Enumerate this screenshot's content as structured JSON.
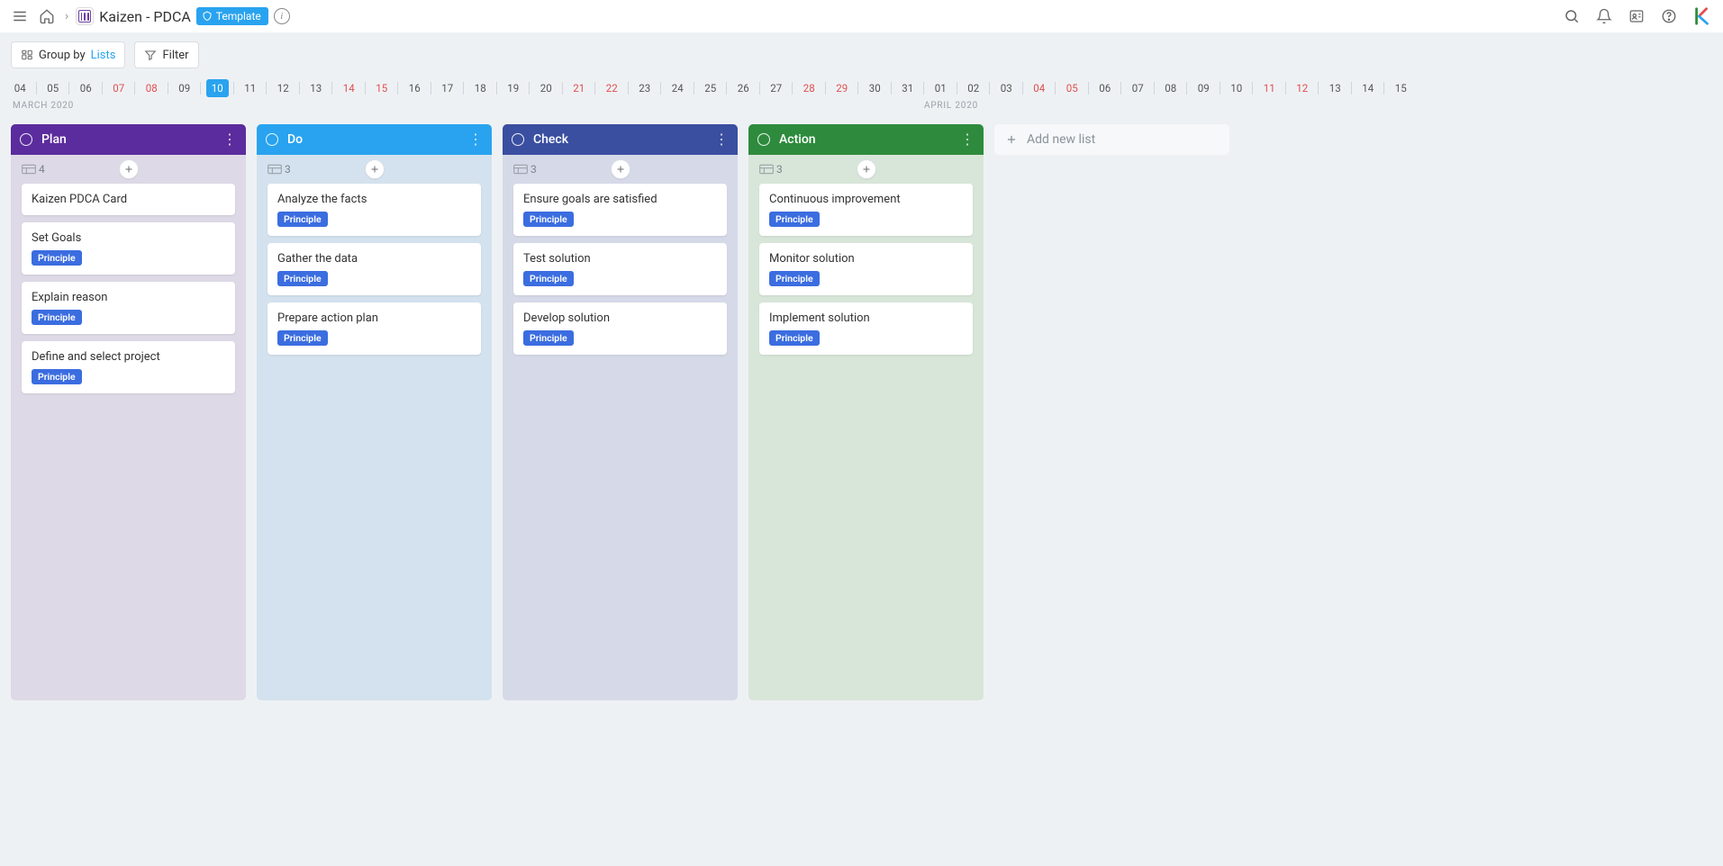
{
  "header": {
    "title": "Kaizen - PDCA",
    "template_label": "Template"
  },
  "toolbar": {
    "group_by_label": "Group by",
    "group_by_value": "Lists",
    "filter_label": "Filter"
  },
  "timeline": {
    "month_left": "MARCH 2020",
    "month_right": "APRIL 2020",
    "selected": "10",
    "days": [
      {
        "d": "04",
        "weekend": false
      },
      {
        "d": "05",
        "weekend": false
      },
      {
        "d": "06",
        "weekend": false
      },
      {
        "d": "07",
        "weekend": true
      },
      {
        "d": "08",
        "weekend": true
      },
      {
        "d": "09",
        "weekend": false
      },
      {
        "d": "10",
        "weekend": false
      },
      {
        "d": "11",
        "weekend": false
      },
      {
        "d": "12",
        "weekend": false
      },
      {
        "d": "13",
        "weekend": false
      },
      {
        "d": "14",
        "weekend": true
      },
      {
        "d": "15",
        "weekend": true
      },
      {
        "d": "16",
        "weekend": false
      },
      {
        "d": "17",
        "weekend": false
      },
      {
        "d": "18",
        "weekend": false
      },
      {
        "d": "19",
        "weekend": false
      },
      {
        "d": "20",
        "weekend": false
      },
      {
        "d": "21",
        "weekend": true
      },
      {
        "d": "22",
        "weekend": true
      },
      {
        "d": "23",
        "weekend": false
      },
      {
        "d": "24",
        "weekend": false
      },
      {
        "d": "25",
        "weekend": false
      },
      {
        "d": "26",
        "weekend": false
      },
      {
        "d": "27",
        "weekend": false
      },
      {
        "d": "28",
        "weekend": true
      },
      {
        "d": "29",
        "weekend": true
      },
      {
        "d": "30",
        "weekend": false
      },
      {
        "d": "31",
        "weekend": false
      },
      {
        "d": "01",
        "weekend": false
      },
      {
        "d": "02",
        "weekend": false
      },
      {
        "d": "03",
        "weekend": false
      },
      {
        "d": "04",
        "weekend": true
      },
      {
        "d": "05",
        "weekend": true
      },
      {
        "d": "06",
        "weekend": false
      },
      {
        "d": "07",
        "weekend": false
      },
      {
        "d": "08",
        "weekend": false
      },
      {
        "d": "09",
        "weekend": false
      },
      {
        "d": "10",
        "weekend": false
      },
      {
        "d": "11",
        "weekend": true
      },
      {
        "d": "12",
        "weekend": true
      },
      {
        "d": "13",
        "weekend": false
      },
      {
        "d": "14",
        "weekend": false
      },
      {
        "d": "15",
        "weekend": false
      }
    ]
  },
  "board": {
    "add_list_label": "Add new list",
    "columns": [
      {
        "key": "plan",
        "title": "Plan",
        "count": "4",
        "cards": [
          {
            "title": "Kaizen PDCA Card",
            "label": null
          },
          {
            "title": "Set Goals",
            "label": "Principle"
          },
          {
            "title": "Explain reason",
            "label": "Principle"
          },
          {
            "title": "Define and select project",
            "label": "Principle"
          }
        ]
      },
      {
        "key": "do",
        "title": "Do",
        "count": "3",
        "cards": [
          {
            "title": "Analyze the facts",
            "label": "Principle"
          },
          {
            "title": "Gather the data",
            "label": "Principle"
          },
          {
            "title": "Prepare action plan",
            "label": "Principle"
          }
        ]
      },
      {
        "key": "check",
        "title": "Check",
        "count": "3",
        "cards": [
          {
            "title": "Ensure goals are satisfied",
            "label": "Principle"
          },
          {
            "title": "Test solution",
            "label": "Principle"
          },
          {
            "title": "Develop solution",
            "label": "Principle"
          }
        ]
      },
      {
        "key": "action",
        "title": "Action",
        "count": "3",
        "cards": [
          {
            "title": "Continuous improvement",
            "label": "Principle"
          },
          {
            "title": "Monitor solution",
            "label": "Principle"
          },
          {
            "title": "Implement solution",
            "label": "Principle"
          }
        ]
      }
    ]
  }
}
